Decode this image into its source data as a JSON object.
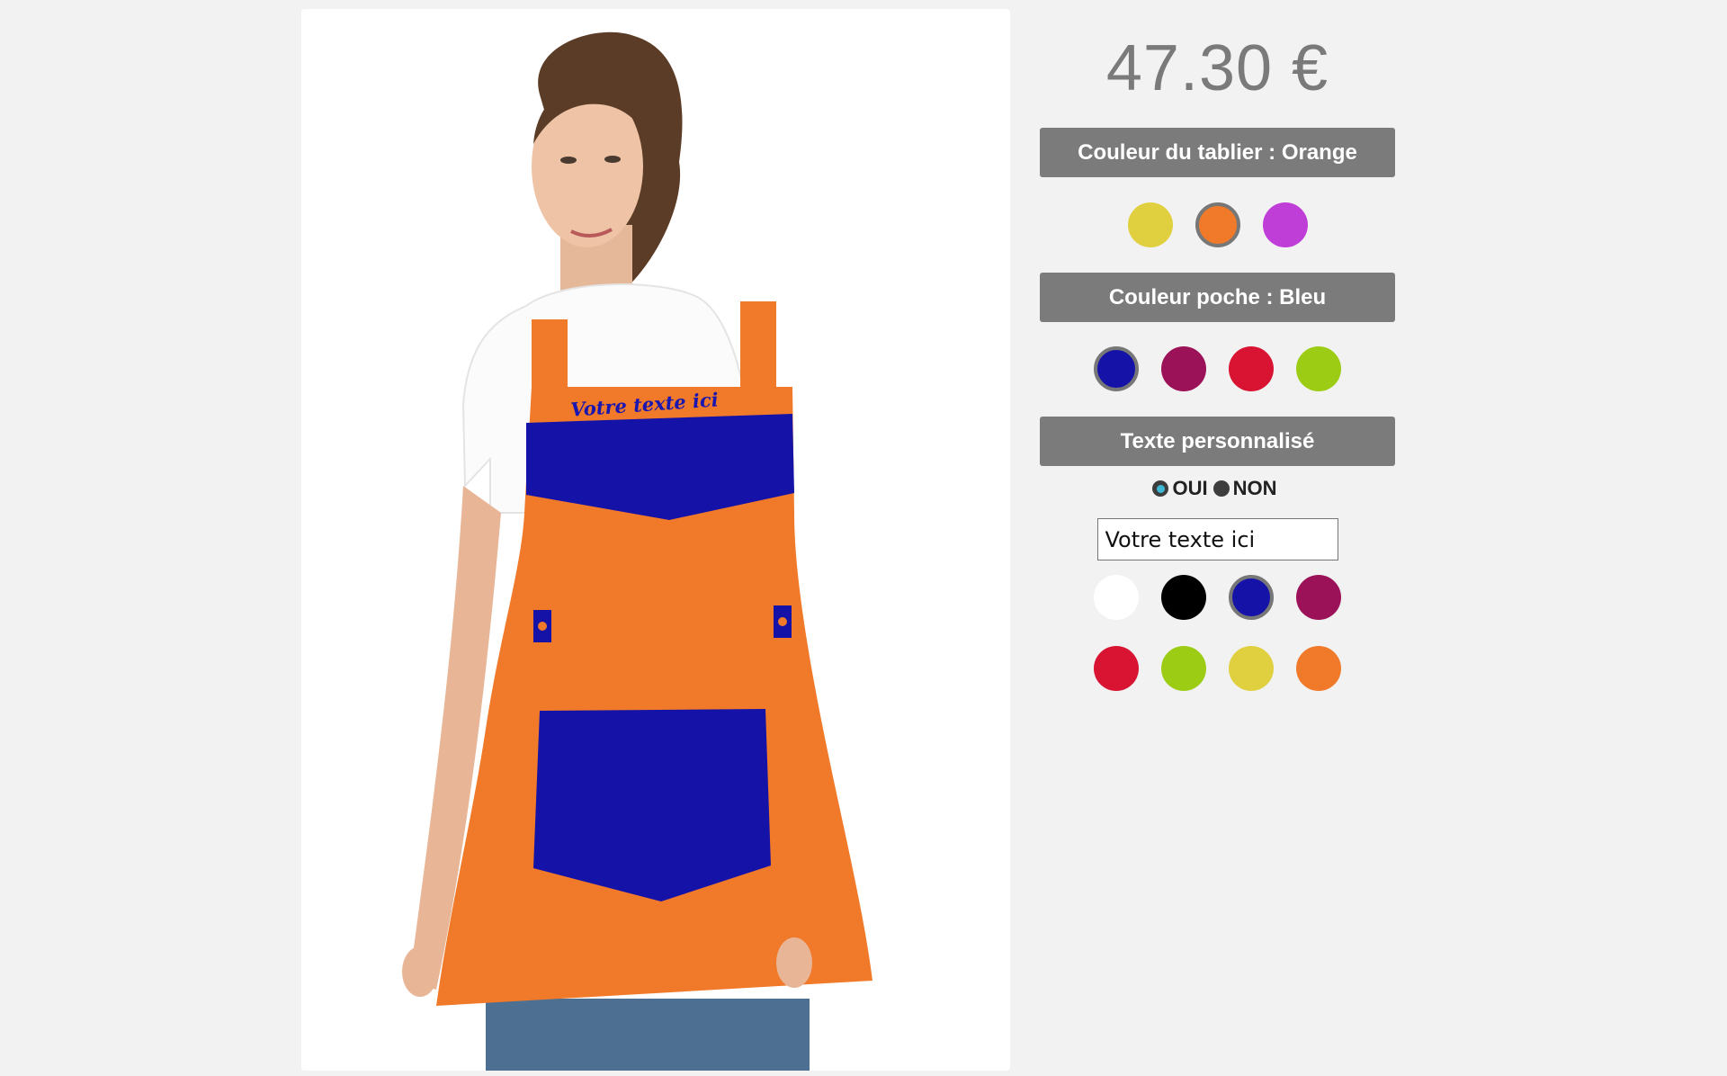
{
  "product": {
    "price": "47.30 €",
    "image_alt": "Woman wearing an orange apron with blue chest panel and blue pocket",
    "apron_print_text": "Votre texte ici"
  },
  "apron_color": {
    "header": "Couleur du tablier : Orange",
    "selected": "Orange",
    "swatches": [
      {
        "name": "Jaune",
        "color": "#e0d040",
        "selected": false
      },
      {
        "name": "Orange",
        "color": "#f07a2a",
        "selected": true
      },
      {
        "name": "Violet",
        "color": "#c03ed8",
        "selected": false
      }
    ]
  },
  "pocket_color": {
    "header": "Couleur poche : Bleu",
    "selected": "Bleu",
    "swatches": [
      {
        "name": "Bleu",
        "color": "#1512a8",
        "selected": true
      },
      {
        "name": "Bordeaux",
        "color": "#9c1258",
        "selected": false
      },
      {
        "name": "Rouge",
        "color": "#d81432",
        "selected": false
      },
      {
        "name": "Vert",
        "color": "#9ccc14",
        "selected": false
      }
    ]
  },
  "custom_text": {
    "header": "Texte personnalisé",
    "options": [
      {
        "label": "OUI",
        "checked": true
      },
      {
        "label": "NON",
        "checked": false
      }
    ],
    "input_value": "Votre texte ici",
    "text_colors_row1": [
      {
        "name": "Blanc",
        "color": "#ffffff",
        "selected": false
      },
      {
        "name": "Noir",
        "color": "#000000",
        "selected": false
      },
      {
        "name": "Bleu",
        "color": "#1512a8",
        "selected": true
      },
      {
        "name": "Bordeaux",
        "color": "#9c1258",
        "selected": false
      }
    ],
    "text_colors_row2": [
      {
        "name": "Rouge",
        "color": "#d81432",
        "selected": false
      },
      {
        "name": "Vert",
        "color": "#9ccc14",
        "selected": false
      },
      {
        "name": "Jaune",
        "color": "#e0d040",
        "selected": false
      },
      {
        "name": "Orange",
        "color": "#f07a2a",
        "selected": false
      }
    ]
  }
}
